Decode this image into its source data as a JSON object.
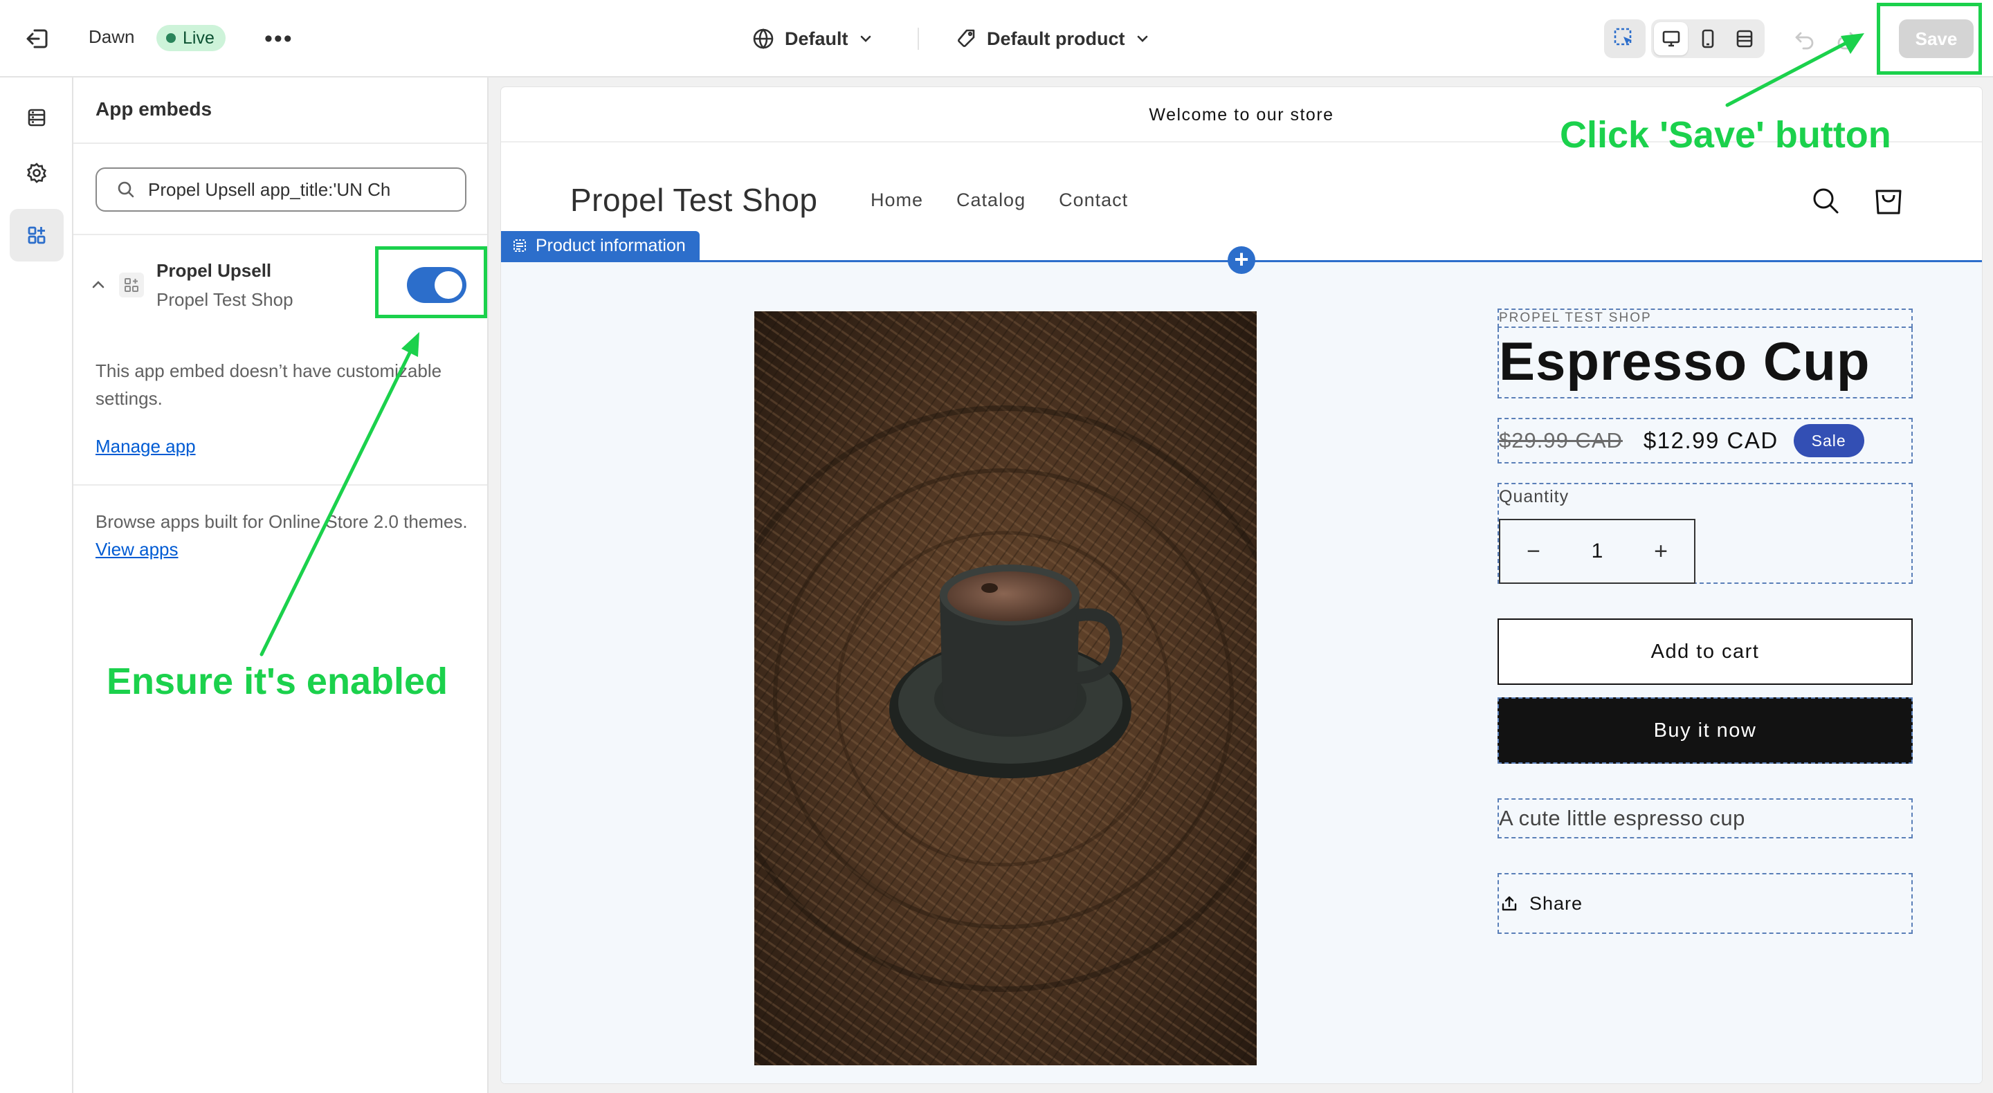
{
  "topbar": {
    "theme_name": "Dawn",
    "status_badge": "Live",
    "template_selector": "Default",
    "product_selector": "Default product",
    "save_label": "Save"
  },
  "sidebar": {
    "title": "App embeds",
    "search_value": "Propel Upsell app_title:'UN Ch",
    "embed": {
      "name": "Propel Upsell",
      "shop": "Propel Test Shop",
      "enabled": true,
      "description": "This app embed doesn’t have customizable settings.",
      "manage_link": "Manage app"
    },
    "browse_text": "Browse apps built for Online Store 2.0 themes.",
    "view_apps_link": "View apps"
  },
  "preview": {
    "announcement": "Welcome to our store",
    "shop_name": "Propel Test Shop",
    "nav": [
      "Home",
      "Catalog",
      "Contact"
    ],
    "section_label": "Product information",
    "product": {
      "vendor": "PROPEL TEST SHOP",
      "title": "Espresso Cup",
      "price_compare": "$29.99 CAD",
      "price": "$12.99 CAD",
      "sale_badge": "Sale",
      "quantity_label": "Quantity",
      "quantity_value": "1",
      "add_to_cart": "Add to cart",
      "buy_now": "Buy it now",
      "description": "A cute little espresso cup",
      "share": "Share"
    }
  },
  "annotations": {
    "save_hint": "Click 'Save' button",
    "toggle_hint": "Ensure it's enabled",
    "color": "#1bd14c"
  },
  "colors": {
    "accent": "#2c6ecb",
    "link": "#005bd3",
    "sale_badge": "#334fb4"
  }
}
